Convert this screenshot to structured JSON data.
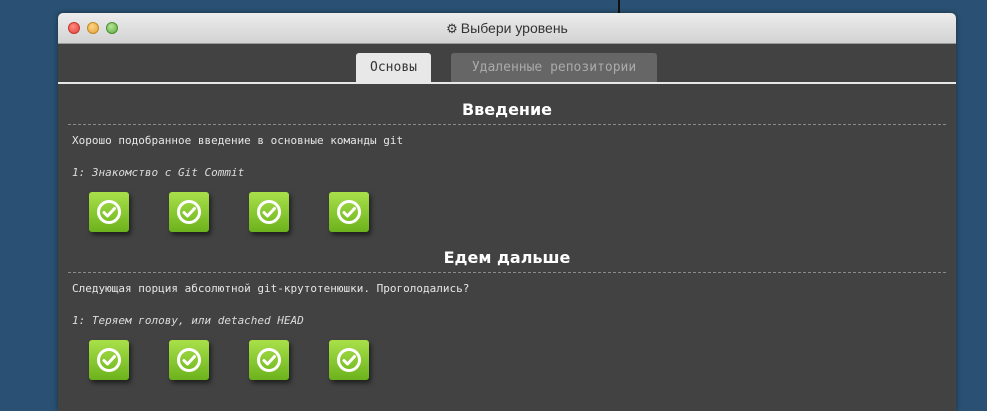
{
  "window": {
    "title": "Выбери уровень",
    "title_icon": "gear-icon"
  },
  "tabs": [
    {
      "label": "Основы",
      "active": true
    },
    {
      "label": "Удаленные репозитории",
      "active": false
    }
  ],
  "sections": [
    {
      "title": "Введение",
      "description": "Хорошо подобранное введение в основные команды git",
      "sublevel": "1: Знакомство с Git Commit",
      "levels": [
        {
          "status": "completed",
          "icon": "checkmark-icon"
        },
        {
          "status": "completed",
          "icon": "checkmark-icon"
        },
        {
          "status": "completed",
          "icon": "checkmark-icon"
        },
        {
          "status": "completed",
          "icon": "checkmark-icon"
        }
      ]
    },
    {
      "title": "Едем дальше",
      "description": "Следующая порция абсолютной git-крутотенюшки. Проголодались?",
      "sublevel": "1: Теряем голову, или detached HEAD",
      "levels": [
        {
          "status": "completed",
          "icon": "checkmark-icon"
        },
        {
          "status": "completed",
          "icon": "checkmark-icon"
        },
        {
          "status": "completed",
          "icon": "checkmark-icon"
        },
        {
          "status": "completed",
          "icon": "checkmark-icon"
        }
      ]
    }
  ],
  "colors": {
    "desktop_background": "#2a5173",
    "window_background": "#424242",
    "level_complete_green": "#8ccd30"
  }
}
